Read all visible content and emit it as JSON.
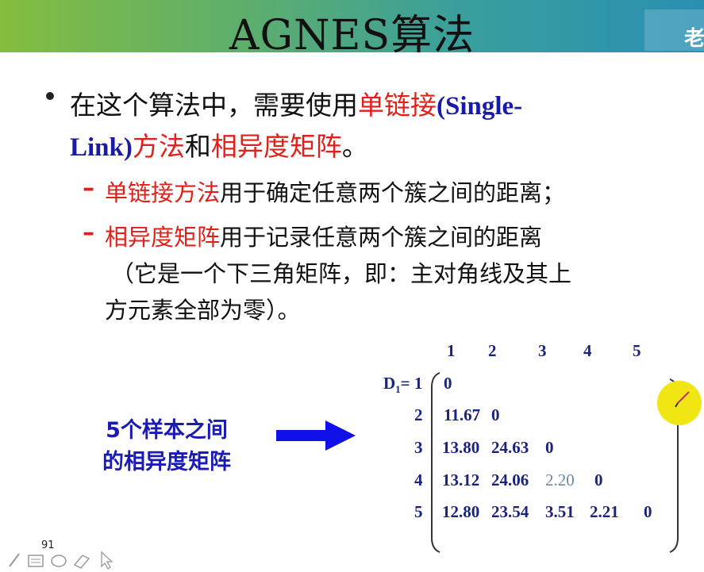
{
  "slide": {
    "title": "AGNES算法",
    "corner_char": "老",
    "page_number": "91"
  },
  "bullet": {
    "part1": "在这个算法中，需要使用",
    "part2_red": "单链接",
    "part3_blue": "(Single-",
    "part4_blue": "Link)",
    "part5_red": "方法",
    "part6": "和",
    "part7_red": "相异度矩阵",
    "part8": "。"
  },
  "subbullets": [
    {
      "dash": "–",
      "red": "单链接方法",
      "text": "用于确定任意两个簇之间的距离；"
    },
    {
      "dash": "–",
      "red": "相异度矩阵",
      "text": "用于记录任意两个簇之间的距离",
      "line2": "（它是一个下三角矩阵，即：主对角线及其上",
      "line3": "方元素全部为零）。"
    }
  ],
  "side_label": {
    "line1": "5个样本之间",
    "line2": "的相异度矩阵"
  },
  "matrix": {
    "label": "D",
    "label_sub": "1",
    "label_suffix": "= 1",
    "col_headers": [
      "1",
      "2",
      "3",
      "4",
      "5"
    ],
    "row_headers": [
      "2",
      "3",
      "4",
      "5"
    ],
    "rows": [
      [
        "0"
      ],
      [
        "11.67",
        "0"
      ],
      [
        "13.80",
        "24.63",
        "0"
      ],
      [
        "13.12",
        "24.06",
        "2.20",
        "0"
      ],
      [
        "12.80",
        "23.54",
        "3.51",
        "2.21",
        "0"
      ]
    ]
  },
  "colors": {
    "red": "#e0201a",
    "blue": "#1a1aa8",
    "header_gradient_start": "#84bd3f",
    "header_gradient_end": "#2a8fb2"
  }
}
